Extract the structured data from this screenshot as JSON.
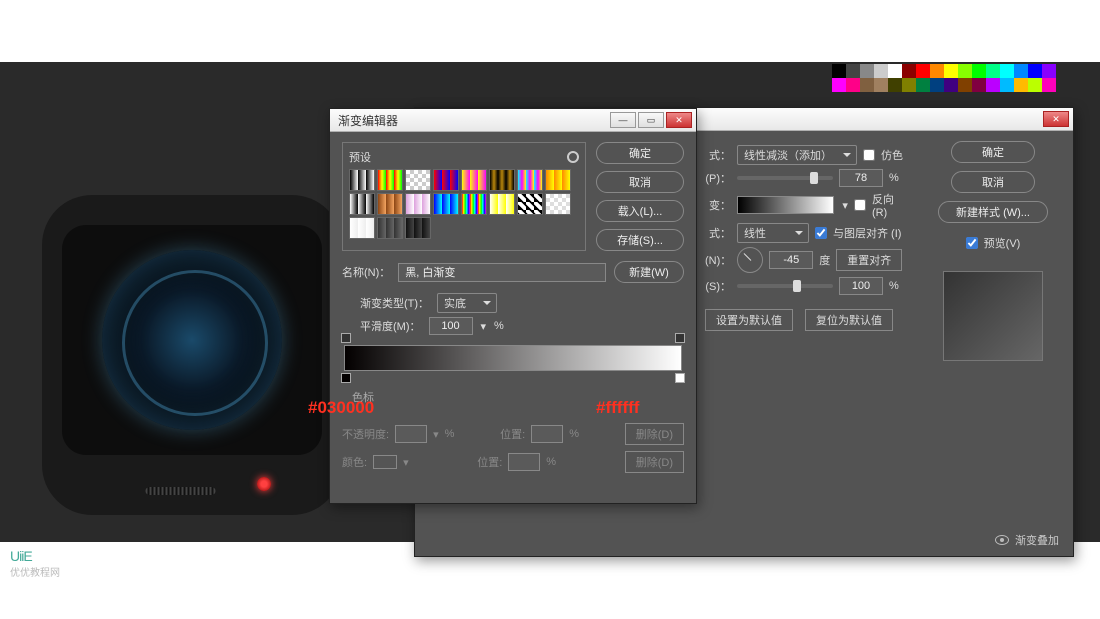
{
  "watermark": {
    "brand": "UiiE",
    "text": "优优教程网"
  },
  "swatch_colors": [
    "#000",
    "#444",
    "#888",
    "#ccc",
    "#fff",
    "#8b0000",
    "#f00",
    "#f80",
    "#ff0",
    "#8f0",
    "#0f0",
    "#0f8",
    "#0ff",
    "#08f",
    "#00f",
    "#80f",
    "#f0f",
    "#f08",
    "#806040",
    "#a08060",
    "#404000",
    "#808000",
    "#008040",
    "#004080",
    "#400080",
    "#804000",
    "#800040",
    "#b0f",
    "#0bf",
    "#fb0",
    "#bf0",
    "#f0b"
  ],
  "back_dialog": {
    "title": "",
    "buttons": {
      "ok": "确定",
      "cancel": "取消",
      "new_style": "新建样式 (W)..."
    },
    "preview_cb": "预览(V)",
    "fields": {
      "blend_label": "式：",
      "blend_value": "线性减淡（添加）",
      "opacity_label": "(P)：",
      "opacity_value": "78",
      "opacity_unit": "%",
      "dither_cb": "仿色",
      "gradient_label": "变：",
      "reverse_cb": "反向(R)",
      "style_label": "式：",
      "style_value": "线性",
      "align_cb": "与图层对齐 (I)",
      "angle_label": "(N)：",
      "angle_value": "-45",
      "angle_unit": "度",
      "reset_align": "重置对齐",
      "scale_label": "(S)：",
      "scale_value": "100",
      "scale_unit": "%",
      "set_default": "设置为默认值",
      "reset_default": "复位为默认值"
    },
    "footer": "渐变叠加"
  },
  "front_dialog": {
    "title": "渐变编辑器",
    "presets_label": "预设",
    "buttons": {
      "ok": "确定",
      "cancel": "取消",
      "load": "载入(L)...",
      "save": "存储(S)...",
      "new": "新建(W)"
    },
    "name_label": "名称(N)：",
    "name_value": "黑, 白渐变",
    "type_label": "渐变类型(T)：",
    "type_value": "实底",
    "smooth_label": "平滑度(M)：",
    "smooth_value": "100",
    "smooth_unit": "%",
    "stop_section": "色标",
    "opacity_label": "不透明度:",
    "opacity_unit": "%",
    "position_label": "位置:",
    "position_unit": "%",
    "delete": "删除(D)",
    "color_label": "颜色:",
    "hex_left": "#030000",
    "hex_right": "#ffffff",
    "preset_gradients": [
      "linear-gradient(90deg,#000,#fff)",
      "linear-gradient(90deg,#f00,#ff0,#0f0)",
      "repeating-conic-gradient(#ccc 0 25%,#fff 0 50%)",
      "linear-gradient(90deg,#f00,#00f)",
      "linear-gradient(90deg,#ff0,#f0f)",
      "linear-gradient(90deg,#000,#b8860b,#000)",
      "linear-gradient(90deg,#0ff,#f0f,#ff0)",
      "linear-gradient(90deg,#f80,#ff0)",
      "linear-gradient(90deg,#fff,#000)",
      "linear-gradient(90deg,#8b4513,#f4a460)",
      "linear-gradient(90deg,#dda0dd,#fff)",
      "linear-gradient(90deg,#00f,#0ff)",
      "linear-gradient(90deg,#f00,#ff0,#0f0,#0ff,#00f,#f0f)",
      "linear-gradient(90deg,#fff,#ff0)",
      "repeating-linear-gradient(45deg,#000 0 4px,#fff 4px 8px)",
      "repeating-conic-gradient(#ddd 0 25%,#fff 0 50%)",
      "linear-gradient(90deg,#fff,#eee)",
      "linear-gradient(90deg,#333,#666)",
      "linear-gradient(90deg,#111,#444)"
    ]
  }
}
